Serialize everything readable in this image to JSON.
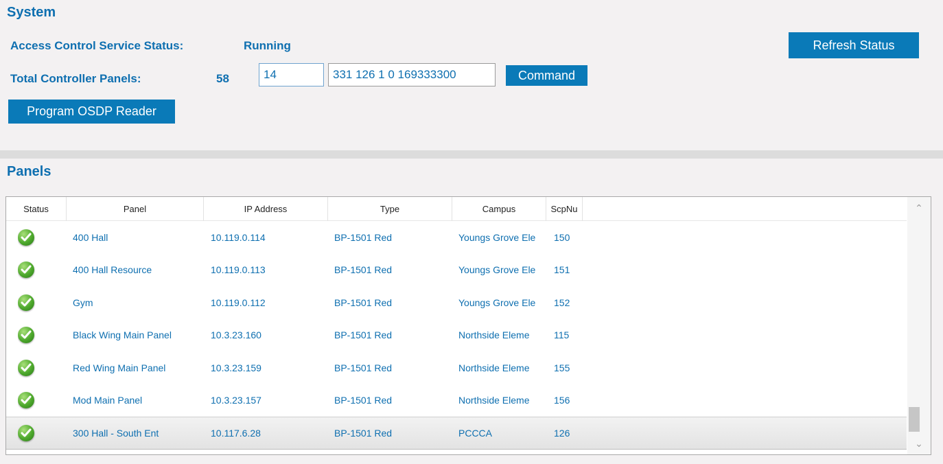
{
  "system": {
    "title": "System",
    "status_label": "Access Control Service Status:",
    "status_value": "Running",
    "panels_label": "Total Controller Panels:",
    "panels_count": "58",
    "panel_input": "14",
    "command_input": "331 126 1 0 169333300",
    "command_button": "Command",
    "program_button": "Program OSDP Reader",
    "refresh_button": "Refresh Status"
  },
  "panels": {
    "title": "Panels",
    "columns": [
      "Status",
      "Panel",
      "IP Address",
      "Type",
      "Campus",
      "ScpNu"
    ],
    "rows": [
      {
        "panel": "400 Hall",
        "ip": "10.119.0.114",
        "type": "BP-1501 Red",
        "campus": "Youngs Grove Ele",
        "scp": "150"
      },
      {
        "panel": "400 Hall Resource",
        "ip": "10.119.0.113",
        "type": "BP-1501 Red",
        "campus": "Youngs Grove Ele",
        "scp": "151"
      },
      {
        "panel": "Gym",
        "ip": "10.119.0.112",
        "type": "BP-1501 Red",
        "campus": "Youngs Grove Ele",
        "scp": "152"
      },
      {
        "panel": "Black Wing Main Panel",
        "ip": "10.3.23.160",
        "type": "BP-1501 Red",
        "campus": "Northside Eleme",
        "scp": "115"
      },
      {
        "panel": "Red Wing Main Panel",
        "ip": "10.3.23.159",
        "type": "BP-1501 Red",
        "campus": "Northside Eleme",
        "scp": "155"
      },
      {
        "panel": "Mod Main Panel",
        "ip": "10.3.23.157",
        "type": "BP-1501 Red",
        "campus": "Northside Eleme",
        "scp": "156"
      },
      {
        "panel": "300 Hall - South Ent",
        "ip": "10.117.6.28",
        "type": "BP-1501 Red",
        "campus": "PCCCA",
        "scp": "126"
      }
    ],
    "status_icon": "green-check-icon",
    "selected_row": 6
  }
}
